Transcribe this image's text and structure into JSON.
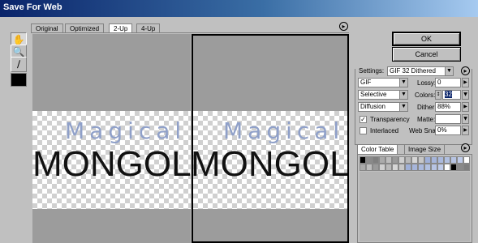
{
  "window": {
    "title": "Save For Web"
  },
  "tabs": [
    "Original",
    "Optimized",
    "2-Up",
    "4-Up"
  ],
  "preview": {
    "line1": "Magical",
    "line2": "MONGOLIA"
  },
  "buttons": {
    "ok": "OK",
    "cancel": "Cancel"
  },
  "settings": {
    "label": "Settings:",
    "preset": "GIF 32 Dithered",
    "format": "GIF",
    "palette": "Selective",
    "dither_algo": "Diffusion",
    "lossy_label": "Lossy:",
    "lossy_value": "0",
    "colors_label": "Colors:",
    "colors_value": "32",
    "dither_label": "Dither:",
    "dither_value": "88%",
    "transparency_label": "Transparency",
    "transparency_checked": true,
    "matte_label": "Matte:",
    "interlaced_label": "Interlaced",
    "interlaced_checked": false,
    "websnap_label": "Web Snap:",
    "websnap_value": "0%"
  },
  "color_table": {
    "tabs": [
      "Color Table",
      "Image Size"
    ],
    "swatches": [
      "#000000",
      "#8a8a8a",
      "#7f7f7f",
      "#aaaaaa",
      "#bdbdbd",
      "#9a9a9a",
      "#cfcfcf",
      "#b9b9b9",
      "#d6d6d6",
      "#c7c7c7",
      "#9fb0d8",
      "#a6b5da",
      "#aab9dd",
      "#b1c0e0",
      "#b7c4e3",
      "#bfcbe8",
      "#ffffff"
    ]
  }
}
